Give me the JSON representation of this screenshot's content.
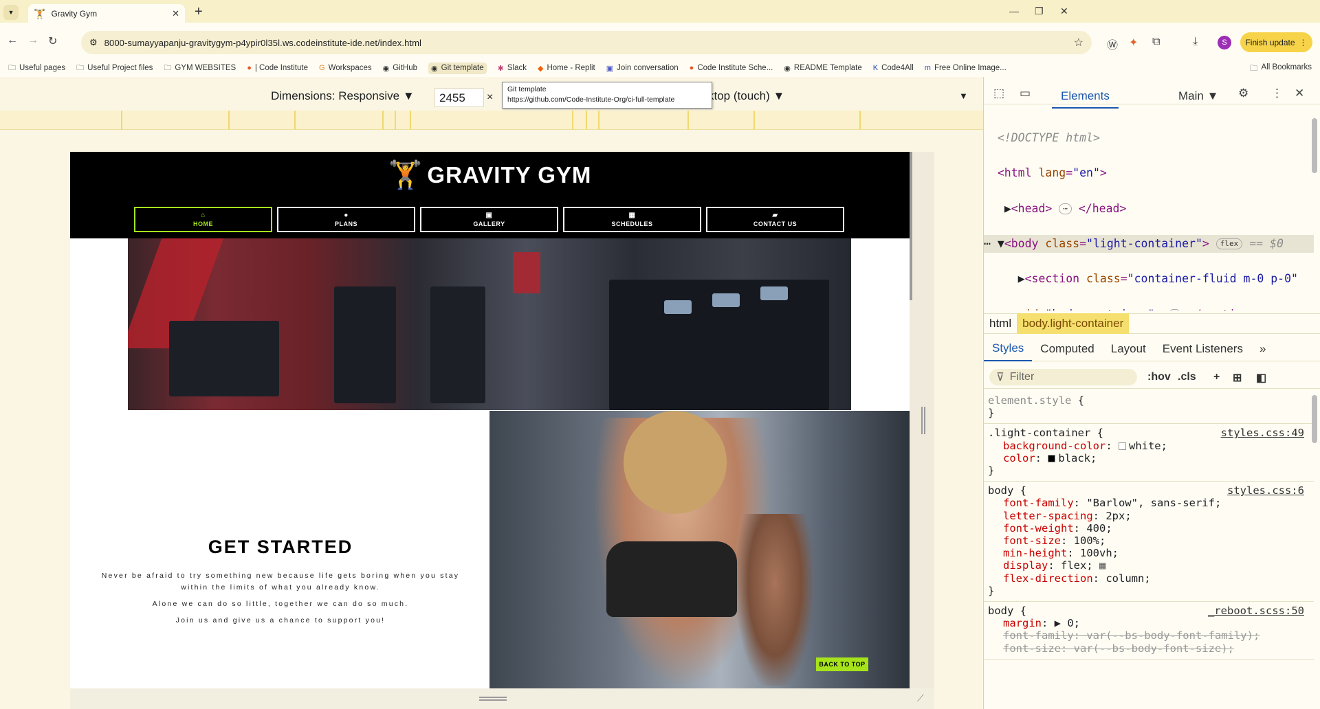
{
  "browser": {
    "tab_title": "Gravity Gym",
    "url": "8000-sumayyapanju-gravitygym-p4ypir0l35l.ws.codeinstitute-ide.net/index.html",
    "finish_update_label": "Finish update",
    "avatar_letter": "S",
    "bookmarks": [
      "Useful pages",
      "Useful Project files",
      "GYM WEBSITES",
      "| Code Institute",
      "Workspaces",
      "GitHub",
      "Git template",
      "Slack",
      "Home - Replit",
      "Join conversation",
      "Code Institute Sche...",
      "README Template",
      "Code4All",
      "Free Online Image..."
    ],
    "all_bookmarks": "All Bookmarks"
  },
  "device_toolbar": {
    "dimensions_label": "Dimensions: Responsive",
    "width_value": "2455",
    "throttle_label": "ktop (touch)",
    "tooltip_title": "Git template",
    "tooltip_url": "https://github.com/Code-Institute-Org/ci-full-template"
  },
  "site": {
    "brand": "GRAVITY GYM",
    "nav": [
      "HOME",
      "PLANS",
      "GALLERY",
      "SCHEDULES",
      "CONTACT US"
    ],
    "get_started_heading": "GET STARTED",
    "paragraphs": [
      "Never be afraid to try something new because life gets boring when you stay within the limits of what you already know.",
      "Alone we can do so little, together we can do so much.",
      "Join us and give us a chance to support you!"
    ],
    "back_to_top": "BACK TO TOP",
    "accent_color": "#a6e31b"
  },
  "devtools": {
    "active_tab": "Elements",
    "main_label": "Main",
    "breadcrumb": [
      "html",
      "body.light-container"
    ],
    "subtabs": [
      "Styles",
      "Computed",
      "Layout",
      "Event Listeners"
    ],
    "filter_placeholder": "Filter",
    "filter_buttons": [
      ":hov",
      ".cls"
    ]
  }
}
